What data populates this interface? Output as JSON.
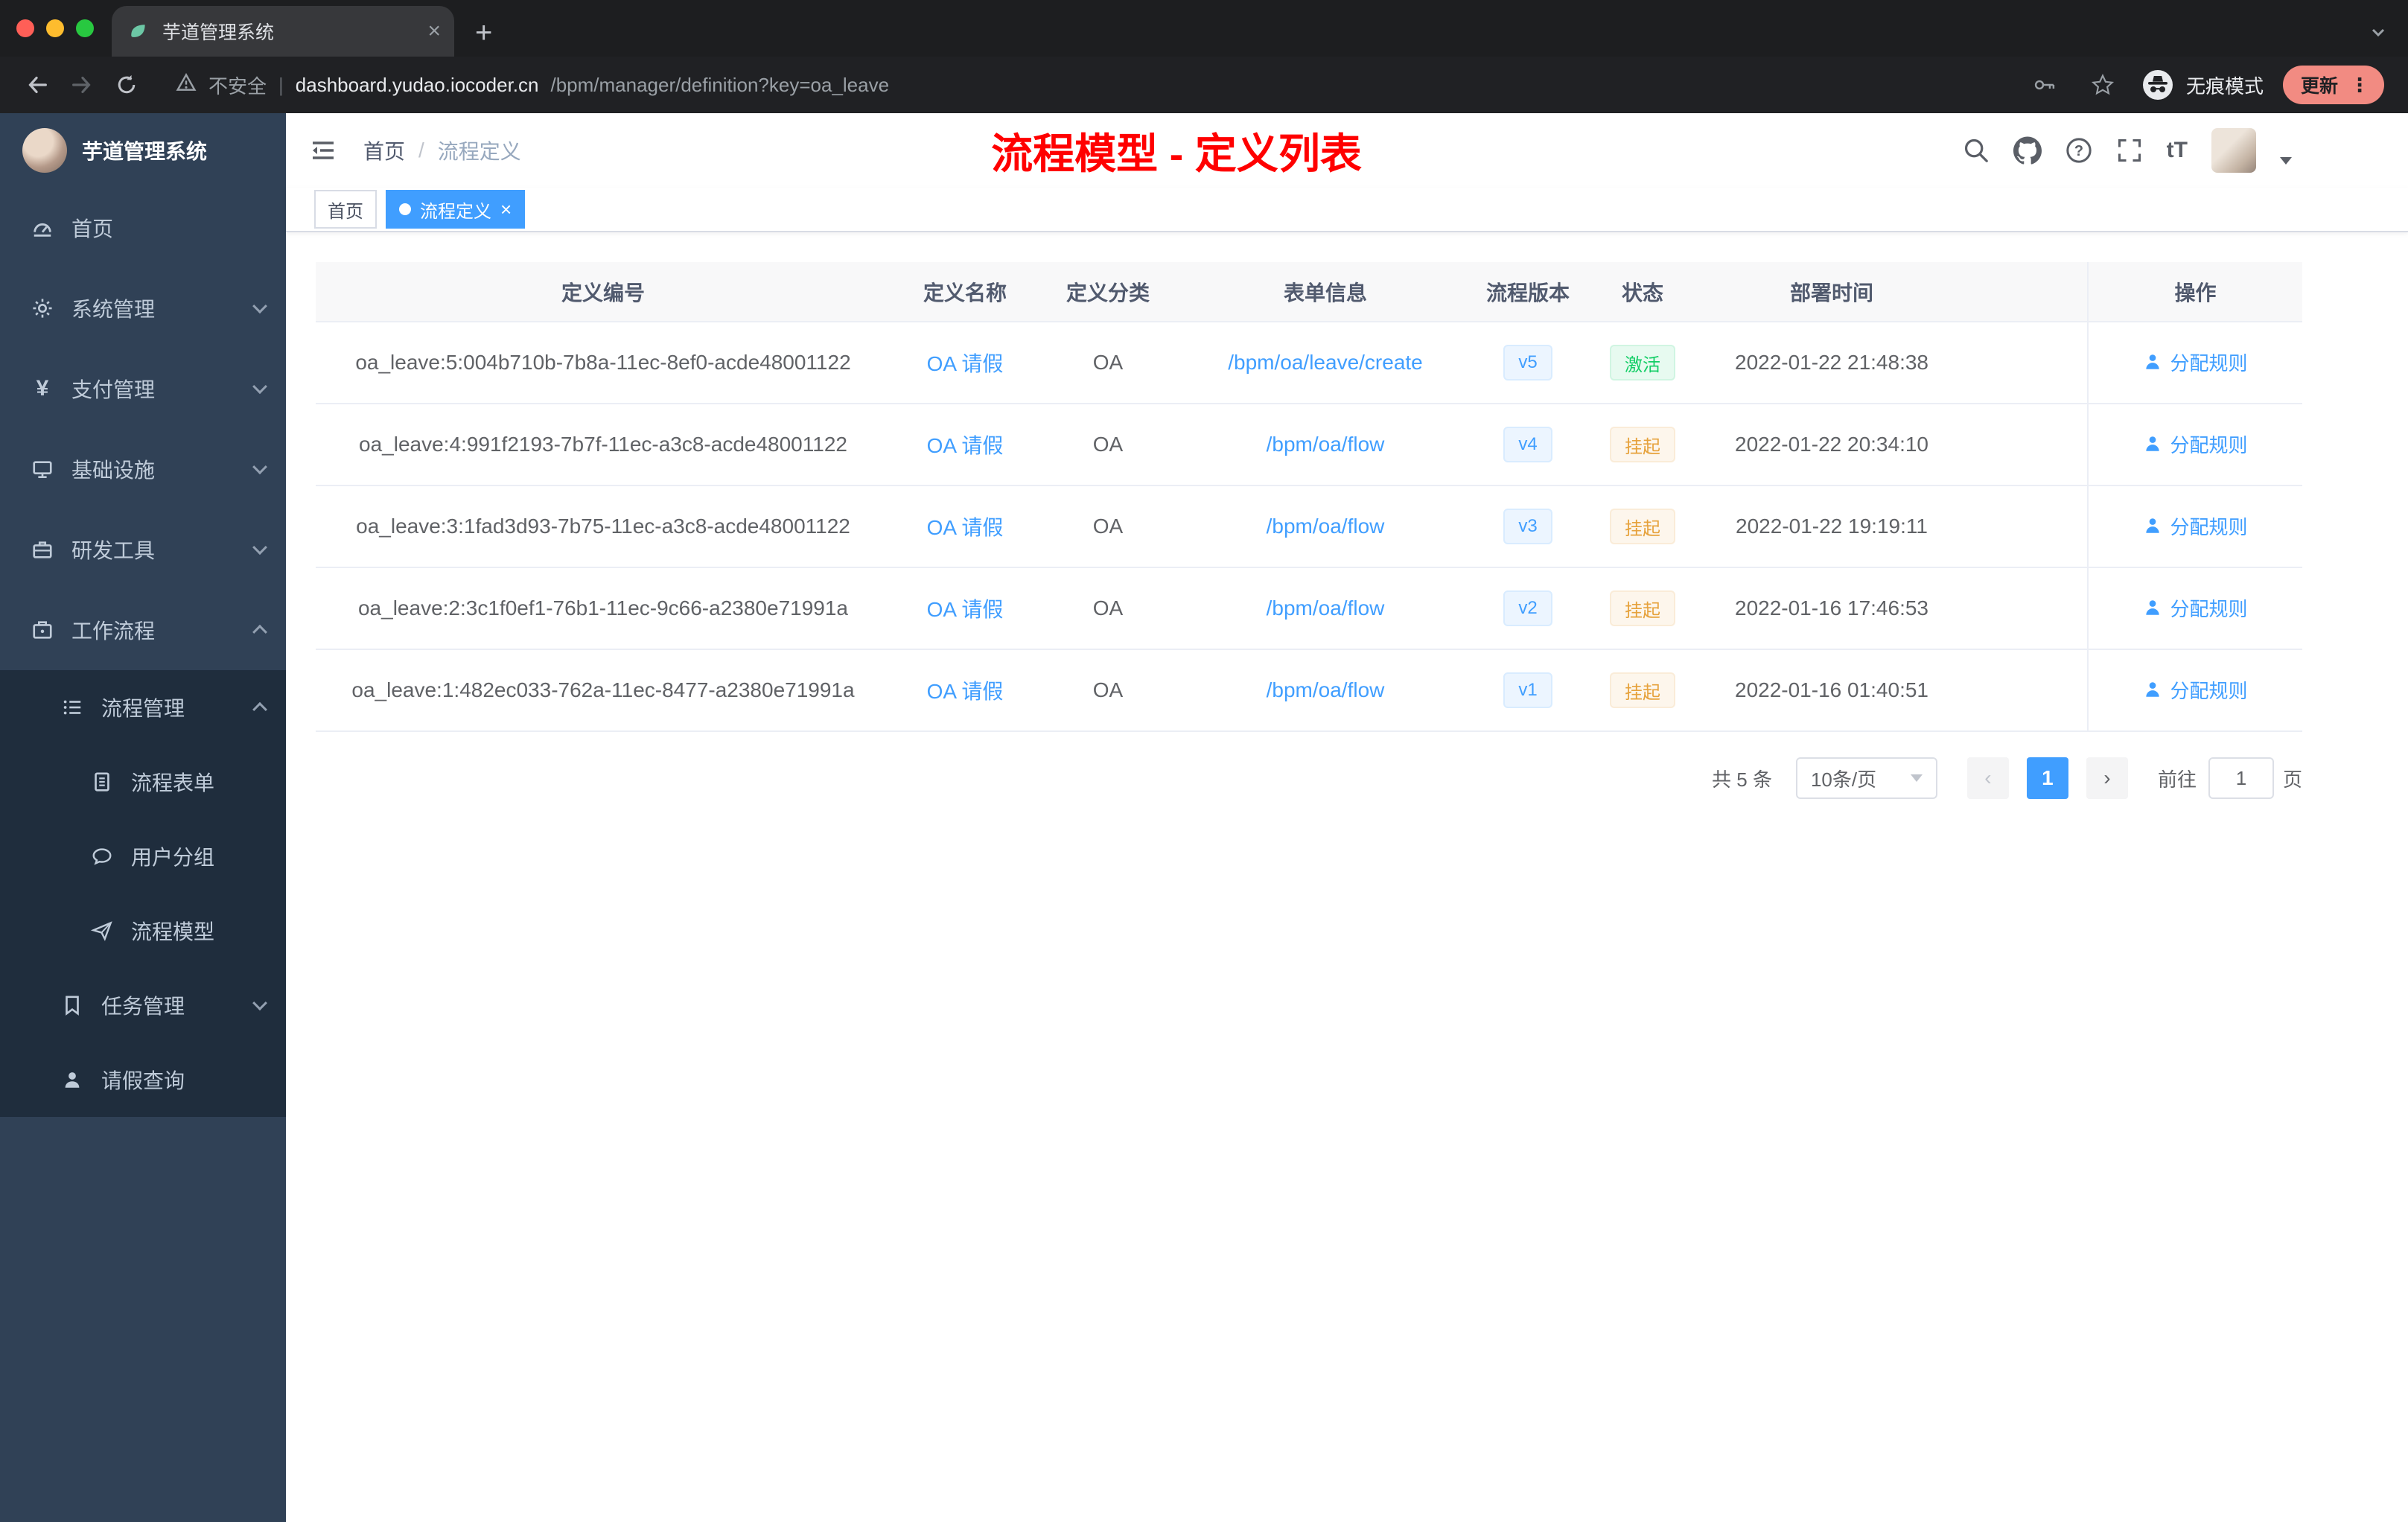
{
  "colors": {
    "accent": "#409eff",
    "title_red": "#ff0000",
    "sidebar_bg": "#304156",
    "submenu_bg": "#1f2d3d",
    "success": "#13ce66",
    "warning": "#e6a23c"
  },
  "browser": {
    "tab_title": "芋道管理系统",
    "security_label": "不安全",
    "url_domain": "dashboard.yudao.iocoder.cn",
    "url_path": "/bpm/manager/definition?key=oa_leave",
    "incognito_label": "无痕模式",
    "update_label": "更新"
  },
  "sidebar": {
    "logo_title": "芋道管理系统",
    "items": [
      {
        "label": "首页",
        "icon": "dashboard-icon",
        "level": 1
      },
      {
        "label": "系统管理",
        "icon": "gear-icon",
        "level": 1,
        "expanded": false
      },
      {
        "label": "支付管理",
        "icon": "yen-icon",
        "level": 1,
        "expanded": false
      },
      {
        "label": "基础设施",
        "icon": "monitor-icon",
        "level": 1,
        "expanded": false
      },
      {
        "label": "研发工具",
        "icon": "toolbox-icon",
        "level": 1,
        "expanded": false
      },
      {
        "label": "工作流程",
        "icon": "briefcase-icon",
        "level": 1,
        "expanded": true
      },
      {
        "label": "流程管理",
        "icon": "list-icon",
        "level": 2,
        "expanded": true
      },
      {
        "label": "流程表单",
        "icon": "document-icon",
        "level": 3
      },
      {
        "label": "用户分组",
        "icon": "chat-icon",
        "level": 3
      },
      {
        "label": "流程模型",
        "icon": "paper-plane-icon",
        "level": 3
      },
      {
        "label": "任务管理",
        "icon": "bookmark-icon",
        "level": 2,
        "expanded": false
      },
      {
        "label": "请假查询",
        "icon": "user-icon",
        "level": 2
      }
    ]
  },
  "header": {
    "breadcrumb": {
      "home": "首页",
      "separator": "/",
      "current": "流程定义"
    },
    "page_title": "流程模型 - 定义列表",
    "font_icon": "tT"
  },
  "tags": {
    "home": "首页",
    "current": "流程定义"
  },
  "table": {
    "columns": [
      "定义编号",
      "定义名称",
      "定义分类",
      "表单信息",
      "流程版本",
      "状态",
      "部署时间",
      "操作"
    ],
    "rows": [
      {
        "id": "oa_leave:5:004b710b-7b8a-11ec-8ef0-acde48001122",
        "name": "OA 请假",
        "category": "OA",
        "form": "/bpm/oa/leave/create",
        "version": "v5",
        "status": "激活",
        "deploy_time": "2022-01-22 21:48:38",
        "action": "分配规则"
      },
      {
        "id": "oa_leave:4:991f2193-7b7f-11ec-a3c8-acde48001122",
        "name": "OA 请假",
        "category": "OA",
        "form": "/bpm/oa/flow",
        "version": "v4",
        "status": "挂起",
        "deploy_time": "2022-01-22 20:34:10",
        "action": "分配规则"
      },
      {
        "id": "oa_leave:3:1fad3d93-7b75-11ec-a3c8-acde48001122",
        "name": "OA 请假",
        "category": "OA",
        "form": "/bpm/oa/flow",
        "version": "v3",
        "status": "挂起",
        "deploy_time": "2022-01-22 19:19:11",
        "action": "分配规则"
      },
      {
        "id": "oa_leave:2:3c1f0ef1-76b1-11ec-9c66-a2380e71991a",
        "name": "OA 请假",
        "category": "OA",
        "form": "/bpm/oa/flow",
        "version": "v2",
        "status": "挂起",
        "deploy_time": "2022-01-16 17:46:53",
        "action": "分配规则"
      },
      {
        "id": "oa_leave:1:482ec033-762a-11ec-8477-a2380e71991a",
        "name": "OA 请假",
        "category": "OA",
        "form": "/bpm/oa/flow",
        "version": "v1",
        "status": "挂起",
        "deploy_time": "2022-01-16 01:40:51",
        "action": "分配规则"
      }
    ]
  },
  "pagination": {
    "total": "共 5 条",
    "page_size": "10条/页",
    "current_page": "1",
    "goto_label": "前往",
    "goto_value": "1",
    "page_unit": "页"
  }
}
